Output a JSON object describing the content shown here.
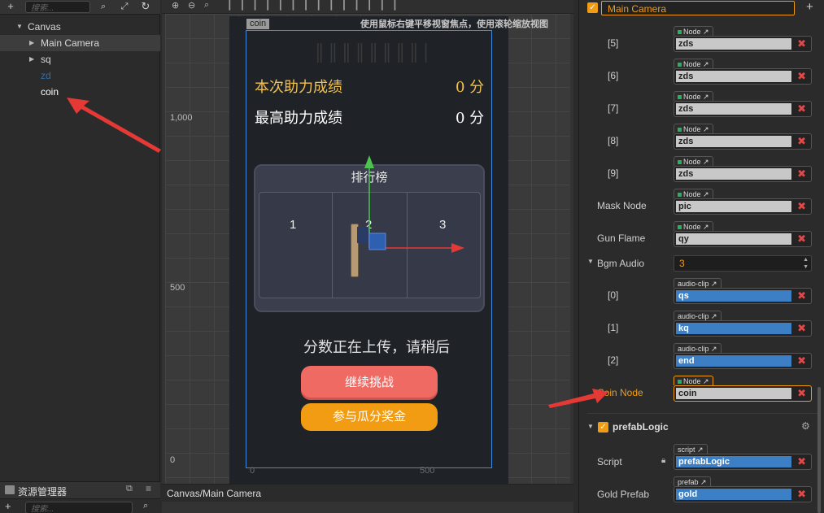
{
  "hierarchy": {
    "search_placeholder": "搜索...",
    "tree": [
      {
        "label": "Canvas"
      },
      {
        "label": "Main Camera"
      },
      {
        "label": "sq"
      },
      {
        "label": "zd"
      },
      {
        "label": "coin"
      }
    ]
  },
  "assets": {
    "title": "资源管理器",
    "search_placeholder": "搜索..."
  },
  "scene": {
    "hint": "使用鼠标右键平移视窗焦点，使用滚轮缩放视图",
    "coin_tag": "coin",
    "axis_labels": [
      "1,000",
      "500",
      "0"
    ],
    "bottom_ticks": [
      "0",
      "500"
    ],
    "score_current_label": "本次助力成绩",
    "score_current_value": "0 分",
    "score_best_label": "最高助力成绩",
    "score_best_value": "0 分",
    "rank_title": "排行榜",
    "rank_1": "1",
    "rank_2": "2",
    "rank_3": "3",
    "upload_text": "分数正在上传，请稍后",
    "continue_button": "继续挑战",
    "prize_button": "参与瓜分奖金",
    "status_path": "Canvas/Main Camera"
  },
  "inspector": {
    "node_name": "Main Camera",
    "props": [
      {
        "label": "[5]",
        "tag": "Node",
        "value": "zds"
      },
      {
        "label": "[6]",
        "tag": "Node",
        "value": "zds"
      },
      {
        "label": "[7]",
        "tag": "Node",
        "value": "zds"
      },
      {
        "label": "[8]",
        "tag": "Node",
        "value": "zds"
      },
      {
        "label": "[9]",
        "tag": "Node",
        "value": "zds"
      },
      {
        "label": "Mask Node",
        "tag": "Node",
        "value": "pic"
      },
      {
        "label": "Gun Flame",
        "tag": "Node",
        "value": "qy"
      }
    ],
    "bgm_label": "Bgm Audio",
    "bgm_count": "3",
    "audio": [
      {
        "label": "[0]",
        "tag": "audio-clip",
        "value": "qs"
      },
      {
        "label": "[1]",
        "tag": "audio-clip",
        "value": "kq"
      },
      {
        "label": "[2]",
        "tag": "audio-clip",
        "value": "end"
      }
    ],
    "coin_node": {
      "label": "Coin Node",
      "tag": "Node",
      "value": "coin"
    },
    "component_name": "prefabLogic",
    "script": {
      "label": "Script",
      "tag": "script",
      "value": "prefabLogic"
    },
    "gold": {
      "label": "Gold Prefab",
      "tag": "prefab",
      "value": "gold"
    }
  },
  "colors": {
    "accent_orange": "#f29c13",
    "gold_text": "#f2c14e",
    "arrow_red": "#e53935",
    "button_red": "#ef6a63"
  }
}
